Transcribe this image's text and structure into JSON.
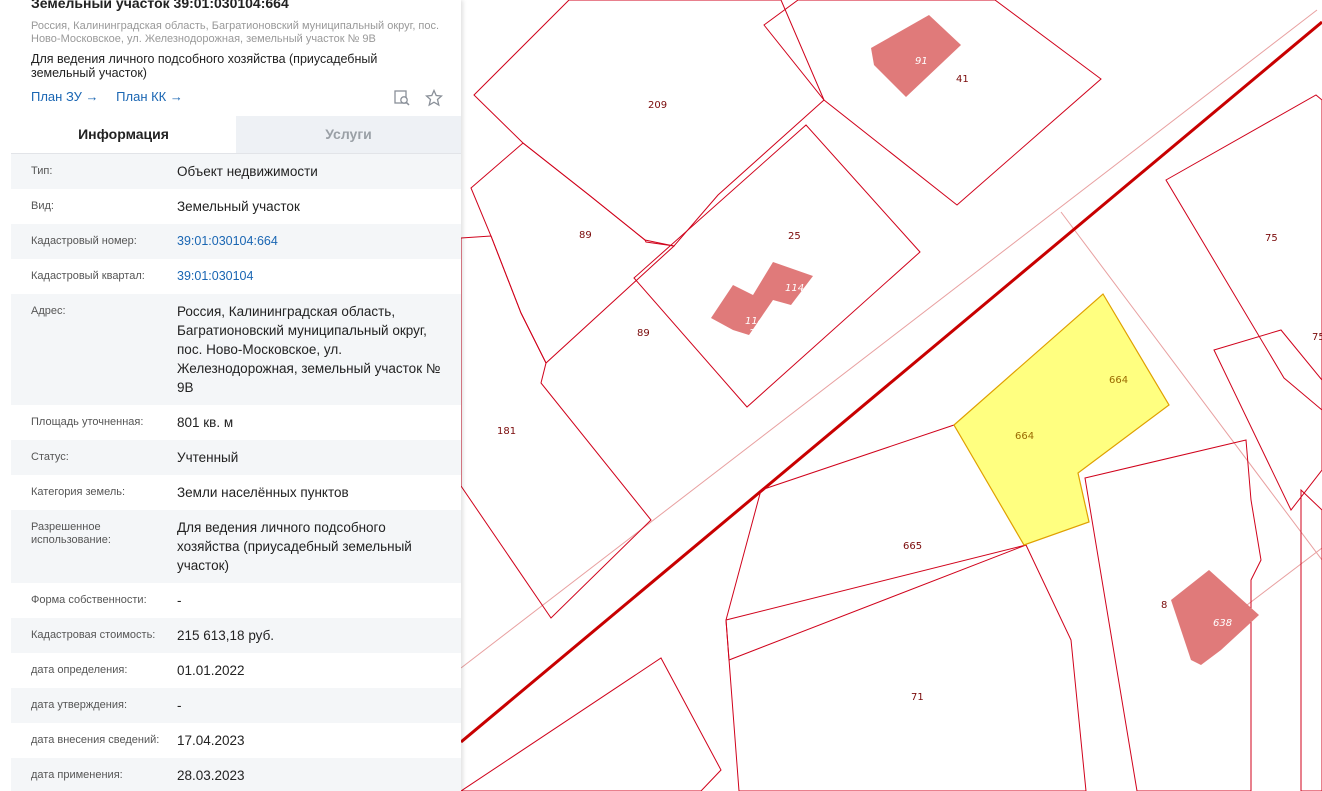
{
  "panel": {
    "title": "Земельный участок 39:01:030104:664",
    "address_short": "Россия, Калининградская область, Багратионовский муниципальный округ, пос. Ново-Московское, ул. Железнодорожная, земельный участок № 9В",
    "usage": "Для ведения личного подсобного хозяйства (приусадебный земельный участок)",
    "links": [
      "План ЗУ →",
      "План КК →"
    ],
    "icons": [
      "map-search-icon",
      "star-icon"
    ],
    "tabs": {
      "info": "Информация",
      "services": "Услуги",
      "active": "info"
    },
    "rows": [
      {
        "key": "Тип:",
        "value": "Объект недвижимости",
        "type": "text"
      },
      {
        "key": "Вид:",
        "value": "Земельный участок",
        "type": "text"
      },
      {
        "key": "Кадастровый номер:",
        "value": "39:01:030104:664",
        "type": "link"
      },
      {
        "key": "Кадастровый квартал:",
        "value": "39:01:030104",
        "type": "link"
      },
      {
        "key": "Адрес:",
        "value": "Россия, Калининградская область, Багратионовский муниципальный округ, пос. Ново-Московское, ул. Железнодорожная, земельный участок № 9В",
        "type": "text"
      },
      {
        "key": "Площадь уточненная:",
        "value": "801 кв. м",
        "type": "text"
      },
      {
        "key": "Статус:",
        "value": "Учтенный",
        "type": "text"
      },
      {
        "key": "Категория земель:",
        "value": "Земли населённых пунктов",
        "type": "text"
      },
      {
        "key": "Разрешенное использование:",
        "value": "Для ведения личного подсобного хозяйства (приусадебный земельный участок)",
        "type": "text"
      },
      {
        "key": "Форма собственности:",
        "value": "-",
        "type": "text"
      },
      {
        "key": "Кадастровая стоимость:",
        "value": "215 613,18 руб.",
        "type": "text"
      },
      {
        "key": "дата определения:",
        "value": "01.01.2022",
        "type": "text"
      },
      {
        "key": "дата утверждения:",
        "value": "-",
        "type": "text"
      },
      {
        "key": "дата внесения сведений:",
        "value": "17.04.2023",
        "type": "text"
      },
      {
        "key": "дата применения:",
        "value": "28.03.2023",
        "type": "text"
      }
    ]
  },
  "map": {
    "colors": {
      "parcel_border": "#d0021b",
      "selected_fill": "#ffff80",
      "building_fill": "#e07a7a",
      "road": "#c80000"
    },
    "parcel_labels": [
      "209",
      "91",
      "41",
      "89",
      "25",
      "114",
      "114",
      "25",
      "89",
      "75",
      "75",
      "664",
      "664",
      "181",
      "665",
      "8",
      "638",
      "71"
    ]
  }
}
